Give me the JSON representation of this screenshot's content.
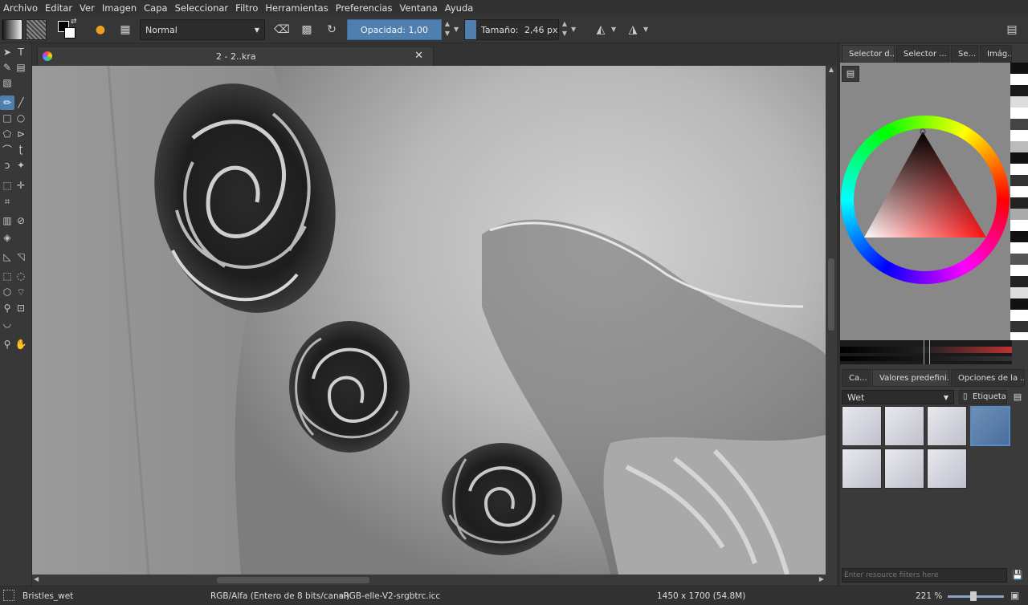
{
  "menu": [
    "Archivo",
    "Editar",
    "Ver",
    "Imagen",
    "Capa",
    "Seleccionar",
    "Filtro",
    "Herramientas",
    "Preferencias",
    "Ventana",
    "Ayuda"
  ],
  "toolbar": {
    "blend_mode": "Normal",
    "opacity_label": "Opacidad:",
    "opacity_value": "1,00",
    "size_label": "Tamaño:",
    "size_value": "2,46 px"
  },
  "document": {
    "tab_title": "2 - 2..kra"
  },
  "right_panel": {
    "top_tabs": [
      "Selector d...",
      "Selector ...",
      "Se...",
      "Imág..."
    ],
    "bottom_tabs": [
      "Ca...",
      "Valores predefini...",
      "Opciones de la ..."
    ],
    "preset_filter": "Wet",
    "tag_label": "Etiqueta",
    "search_placeholder": "Enter resource filters here"
  },
  "status": {
    "brush": "Bristles_wet",
    "color_model": "RGB/Alfa (Entero de 8 bits/canal)",
    "profile": "sRGB-elle-V2-srgbtrc.icc",
    "dimensions": "1450 x 1700 (54.8M)",
    "zoom": "221 %"
  },
  "colors": {
    "accent": "#4f7fae",
    "panel": "#3a3a3a",
    "menubar": "#323232"
  }
}
